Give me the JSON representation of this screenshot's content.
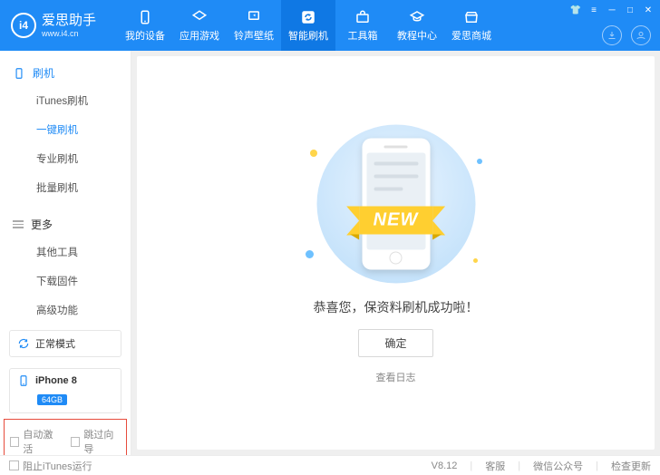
{
  "brand": {
    "name": "爱思助手",
    "site": "www.i4.cn",
    "logo_text": "i4"
  },
  "nav": {
    "items": [
      {
        "label": "我的设备"
      },
      {
        "label": "应用游戏"
      },
      {
        "label": "铃声壁纸"
      },
      {
        "label": "智能刷机"
      },
      {
        "label": "工具箱"
      },
      {
        "label": "教程中心"
      },
      {
        "label": "爱思商城"
      }
    ],
    "active_index": 3
  },
  "sidebar": {
    "group1": {
      "title": "刷机",
      "items": [
        "iTunes刷机",
        "一键刷机",
        "专业刷机",
        "批量刷机"
      ],
      "active_index": 1
    },
    "group2": {
      "title": "更多",
      "items": [
        "其他工具",
        "下载固件",
        "高级功能"
      ]
    }
  },
  "mode": {
    "label": "正常模式"
  },
  "device": {
    "name": "iPhone 8",
    "storage": "64GB"
  },
  "bottom_options": {
    "auto_activate": "自动激活",
    "skip_wizard": "跳过向导"
  },
  "main": {
    "ribbon": "NEW",
    "message": "恭喜您，保资料刷机成功啦！",
    "ok": "确定",
    "log": "查看日志"
  },
  "status": {
    "block_itunes": "阻止iTunes运行",
    "version": "V8.12",
    "support": "客服",
    "wechat": "微信公众号",
    "update": "检查更新"
  }
}
